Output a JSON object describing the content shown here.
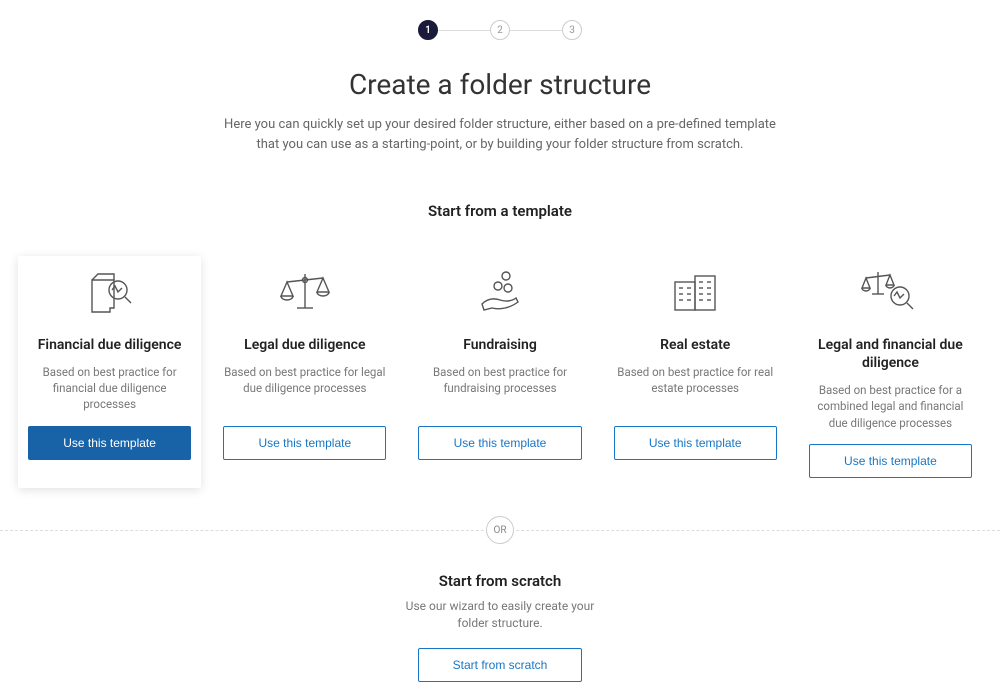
{
  "stepper": {
    "steps": [
      "1",
      "2",
      "3"
    ],
    "active_index": 0
  },
  "header": {
    "title": "Create a folder structure",
    "subtitle": "Here you can quickly set up your desired folder structure, either based on a pre-defined template that you can use as a starting-point, or by building your folder structure from scratch."
  },
  "templates_section_title": "Start from a template",
  "templates": [
    {
      "icon": "document-magnify-icon",
      "title": "Financial due diligence",
      "desc": "Based on best practice for financial due diligence processes",
      "button": "Use this template",
      "selected": true
    },
    {
      "icon": "scales-icon",
      "title": "Legal due diligence",
      "desc": "Based on best practice for legal due diligence processes",
      "button": "Use this template",
      "selected": false
    },
    {
      "icon": "hand-coins-icon",
      "title": "Fundraising",
      "desc": "Based on best practice for fundraising processes",
      "button": "Use this template",
      "selected": false
    },
    {
      "icon": "buildings-icon",
      "title": "Real estate",
      "desc": "Based on best practice for real estate processes",
      "button": "Use this template",
      "selected": false
    },
    {
      "icon": "scales-magnify-icon",
      "title": "Legal and financial due diligence",
      "desc": "Based on best practice for a combined legal and financial due diligence processes",
      "button": "Use this template",
      "selected": false
    }
  ],
  "or_label": "OR",
  "scratch": {
    "title": "Start from scratch",
    "desc": "Use our wizard to easily create your folder structure.",
    "button": "Start from scratch"
  }
}
